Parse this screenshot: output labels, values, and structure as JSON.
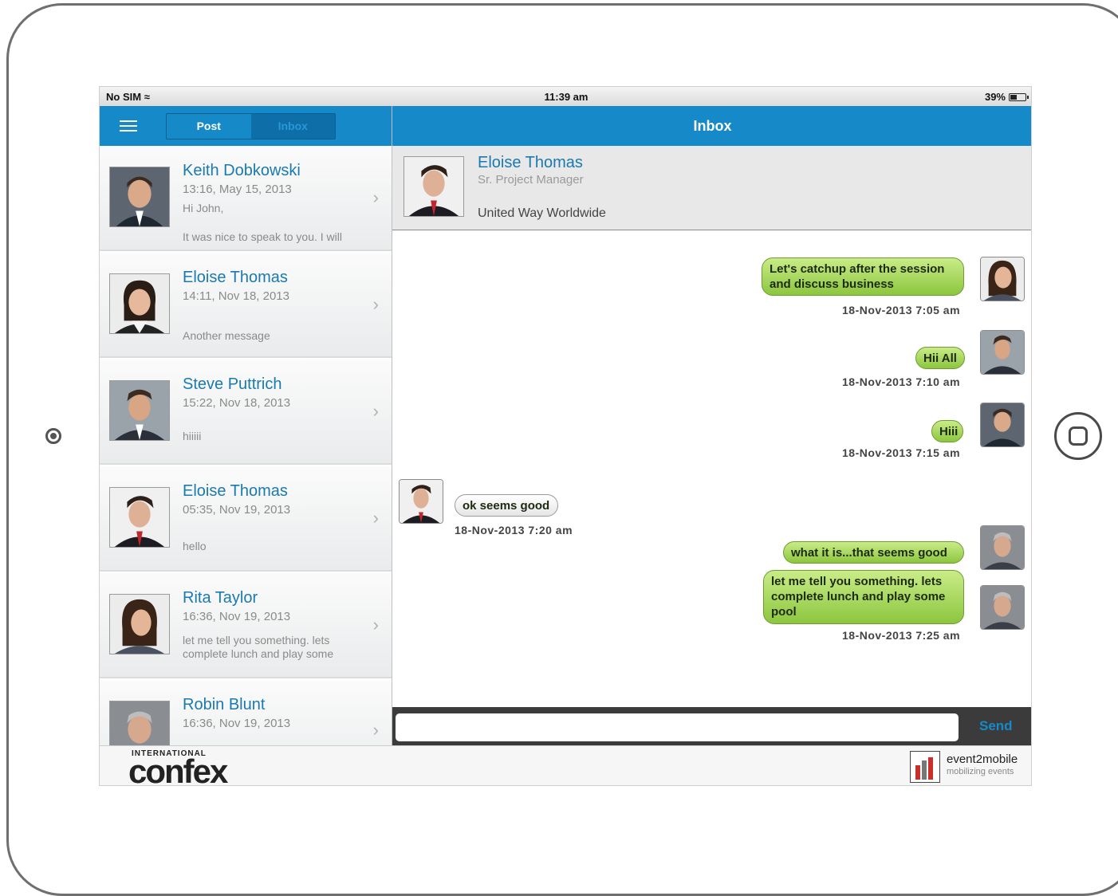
{
  "status": {
    "carrier": "No SIM",
    "time": "11:39 am",
    "battery": "39%"
  },
  "left_header": {
    "post_label": "Post",
    "inbox_label": "Inbox"
  },
  "right_header": {
    "title": "Inbox"
  },
  "conversations": [
    {
      "name": "Keith Dobkowski",
      "date": "13:16, May 15, 2013",
      "msg1": "Hi John,",
      "msg2": "It was nice to speak to you. I will"
    },
    {
      "name": "Eloise Thomas",
      "date": "14:11, Nov 18, 2013",
      "msg1": "Another message"
    },
    {
      "name": "Steve Puttrich",
      "date": "15:22, Nov 18, 2013",
      "msg1": "hiiiii"
    },
    {
      "name": "Eloise Thomas",
      "date": "05:35, Nov 19, 2013",
      "msg1": "hello"
    },
    {
      "name": "Rita Taylor",
      "date": "16:36, Nov 19, 2013",
      "msg1": "let me tell you something. lets complete lunch and play some"
    },
    {
      "name": "Robin Blunt",
      "date": "16:36, Nov 19, 2013"
    }
  ],
  "contact": {
    "name": "Eloise Thomas",
    "title": "Sr. Project Manager",
    "org": "United Way Worldwide"
  },
  "messages": [
    {
      "text": "Let's catchup after the session and discuss business",
      "time": "18-Nov-2013 7:05 am"
    },
    {
      "text": "Hii All",
      "time": "18-Nov-2013 7:10 am"
    },
    {
      "text": "Hiii",
      "time": "18-Nov-2013 7:15 am"
    },
    {
      "text": "ok seems good",
      "time": "18-Nov-2013 7:20 am"
    },
    {
      "text": "what it is...that seems good"
    },
    {
      "text": "let me tell you something. lets complete lunch and play some pool",
      "time": "18-Nov-2013 7:25 am"
    }
  ],
  "composer": {
    "placeholder": "",
    "send_label": "Send"
  },
  "footer": {
    "intl": "INTERNATIONAL",
    "brand": "confex",
    "partner": "event2mobile",
    "partner_tagline": "mobilizing events"
  }
}
